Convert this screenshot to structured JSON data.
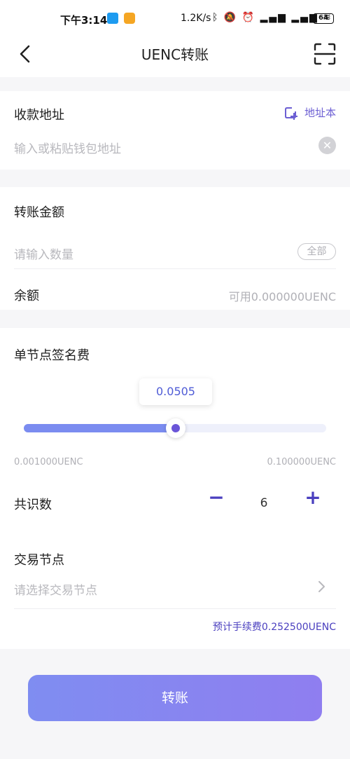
{
  "status_bar": {
    "time": "下午3:14",
    "speed": "1.2K/s",
    "battery": "64",
    "icons": [
      "app-icon-blue",
      "app-icon-orange",
      "bluetooth-icon",
      "mute-icon",
      "alarm-icon",
      "signal-icon",
      "signal-icon",
      "wifi-icon",
      "battery-icon"
    ]
  },
  "nav": {
    "title": "UENC转账",
    "back_icon": "back-arrow-icon",
    "scan_icon": "scan-icon"
  },
  "recipient": {
    "label": "收款地址",
    "address_book_label": "地址本",
    "placeholder": "输入或粘贴钱包地址",
    "clear_icon": "clear-icon"
  },
  "amount": {
    "label": "转账金额",
    "placeholder": "请输入数量",
    "all_label": "全部",
    "balance_label": "余额",
    "balance_value": "可用0.000000UENC"
  },
  "fee": {
    "label": "单节点签名费",
    "current_value": "0.0505",
    "min": "0.001000UENC",
    "max": "0.100000UENC",
    "slider_level_fraction": 0.5
  },
  "consensus": {
    "label": "共识数",
    "minus": "−",
    "value": "6",
    "plus": "+"
  },
  "node": {
    "label": "交易节点",
    "placeholder": "请选择交易节点"
  },
  "estimated_fee": "预计手续费0.252500UENC",
  "submit_label": "转账",
  "colors": {
    "accent": "#4a3fbf",
    "slider_fill": "#7b8cf0",
    "button_gradient_start": "#7f8df1",
    "button_gradient_end": "#8f7ef0"
  }
}
